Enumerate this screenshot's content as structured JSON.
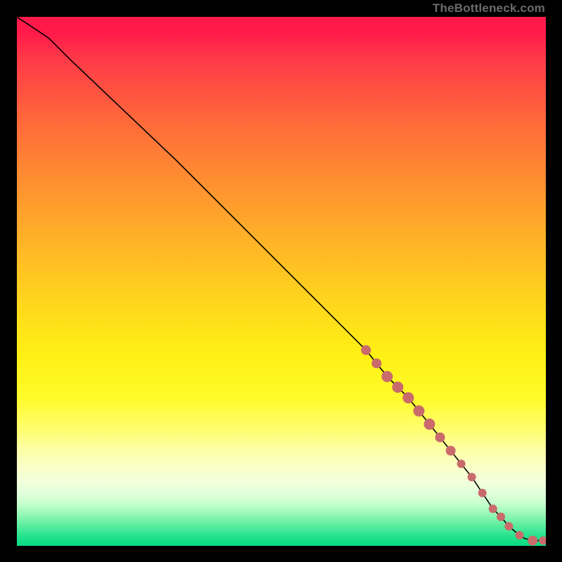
{
  "attribution": "TheBottleneck.com",
  "chart_data": {
    "type": "line",
    "title": "",
    "xlabel": "",
    "ylabel": "",
    "xlim": [
      0,
      100
    ],
    "ylim": [
      0,
      100
    ],
    "grid": false,
    "series": [
      {
        "name": "curve",
        "type": "line",
        "x": [
          0,
          3,
          6,
          10,
          20,
          30,
          40,
          50,
          60,
          66,
          70,
          74,
          78,
          82,
          86,
          88,
          90,
          91.5,
          93,
          95,
          96,
          97.5
        ],
        "y": [
          100,
          98,
          96,
          92,
          82.5,
          73,
          63,
          53,
          43,
          37,
          32,
          28,
          23,
          18,
          13,
          10,
          7,
          5.5,
          3.7,
          2.0,
          1.4,
          1.0
        ]
      },
      {
        "name": "flat-tail",
        "type": "line",
        "x": [
          97.5,
          99.5
        ],
        "y": [
          1.0,
          1.0
        ]
      },
      {
        "name": "markers",
        "type": "scatter",
        "color": "#c96b6b",
        "x": [
          66,
          68,
          70,
          72,
          74,
          76,
          78,
          80,
          82,
          84,
          86,
          88,
          90,
          91.5,
          93,
          95,
          97.5,
          99.5
        ],
        "y": [
          37,
          34.5,
          32,
          30,
          28,
          25.5,
          23,
          20.5,
          18,
          15.5,
          13,
          10,
          7,
          5.5,
          3.7,
          2.0,
          1.0,
          1.0
        ],
        "size": [
          7,
          7,
          8,
          8,
          8,
          8,
          8,
          7,
          7,
          6,
          6,
          6,
          6,
          6,
          6,
          6,
          7,
          6
        ]
      }
    ]
  }
}
